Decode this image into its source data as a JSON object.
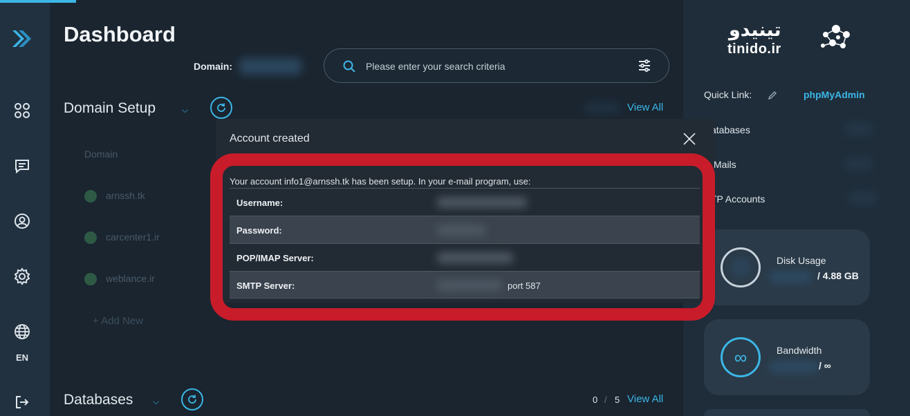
{
  "sidebar": {
    "language": "EN",
    "icons": [
      "logo-icon",
      "apps-icon",
      "chat-icon",
      "user-icon",
      "settings-icon",
      "globe-icon",
      "logout-icon"
    ]
  },
  "header": {
    "title": "Dashboard",
    "domain_label": "Domain:",
    "search_placeholder": "Please enter your search criteria"
  },
  "domain_setup": {
    "title": "Domain Setup",
    "view_all": "View All",
    "column_header": "Domain",
    "domains": [
      "arnssh.tk",
      "carcenter1.ir",
      "weblance.ir"
    ],
    "add_new": "Add New"
  },
  "databases": {
    "title": "Databases",
    "count_used": "0",
    "separator": "/",
    "count_total": "5",
    "view_all": "View All"
  },
  "right_panel": {
    "brand_text": "tinido.ir",
    "brand_persian": "تینیدو",
    "quick_link_label": "Quick Link:",
    "quick_link_value": "phpMyAdmin",
    "list": [
      "atabases",
      "Mails",
      "TP Accounts"
    ],
    "disk_usage_label": "Disk Usage",
    "disk_usage_total": "/  4.88 GB",
    "bandwidth_label": "Bandwidth",
    "bandwidth_total": "/  ∞",
    "bandwidth_symbol": "∞"
  },
  "modal": {
    "title": "Account created",
    "message": "Your account info1@arnssh.tk has been setup. In your e-mail program, use:",
    "rows": [
      {
        "key": "Username:",
        "value": ""
      },
      {
        "key": "Password:",
        "value": ""
      },
      {
        "key": "POP/IMAP Server:",
        "value": ""
      },
      {
        "key": "SMTP Server:",
        "value": "port 587"
      }
    ]
  },
  "colors": {
    "accent": "#3cb6e6",
    "highlight_border": "#c81c2a",
    "background": "#1a2530"
  }
}
